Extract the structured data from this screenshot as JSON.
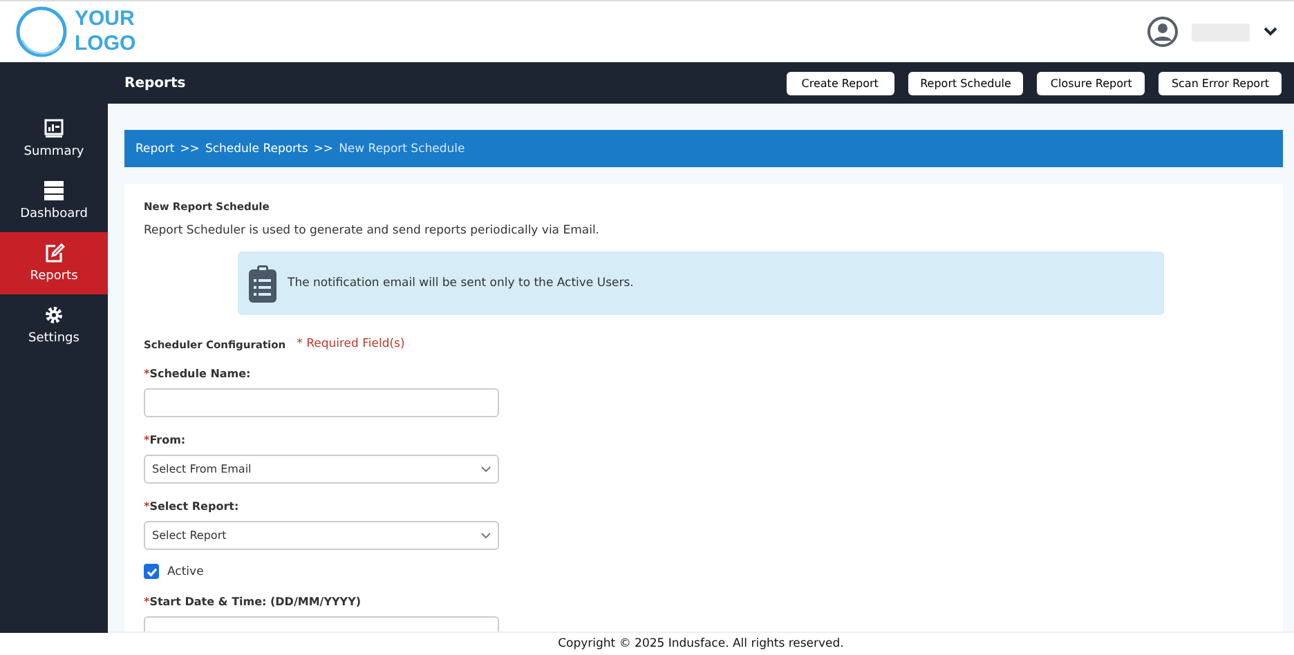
{
  "logo": {
    "line1": "YOUR",
    "line2": "LOGO"
  },
  "page_title": "Reports",
  "top_buttons": [
    "Create Report",
    "Report Schedule",
    "Closure Report",
    "Scan Error Report"
  ],
  "sidebar": {
    "items": [
      {
        "label": "Summary",
        "selected": false
      },
      {
        "label": "Dashboard",
        "selected": false
      },
      {
        "label": "Reports",
        "selected": true
      },
      {
        "label": "Settings",
        "selected": false
      }
    ]
  },
  "breadcrumb": {
    "links": [
      "Report",
      "Schedule Reports"
    ],
    "separator": ">>",
    "current": "New Report Schedule"
  },
  "card": {
    "title": "New Report Schedule",
    "description": "Report Scheduler is used to generate and send reports periodically via Email.",
    "notice": "The notification email will be sent only to the Active Users.",
    "section_title": "Scheduler Configuration",
    "required_note": "* Required Field(s)"
  },
  "fields": [
    {
      "kind": "text",
      "mark": "*",
      "label": "Schedule Name:"
    },
    {
      "kind": "select",
      "mark": "*",
      "label": "From:",
      "value": "Select From Email"
    },
    {
      "kind": "select",
      "mark": "*",
      "label": "Select Report:",
      "value": "Select Report"
    },
    {
      "kind": "checkbox",
      "label": "Active",
      "checked": true
    },
    {
      "kind": "text",
      "mark": "*",
      "label": "Start Date & Time: (DD/MM/YYYY)"
    }
  ],
  "footer": "Copyright © 2025 Indusface. All rights reserved."
}
